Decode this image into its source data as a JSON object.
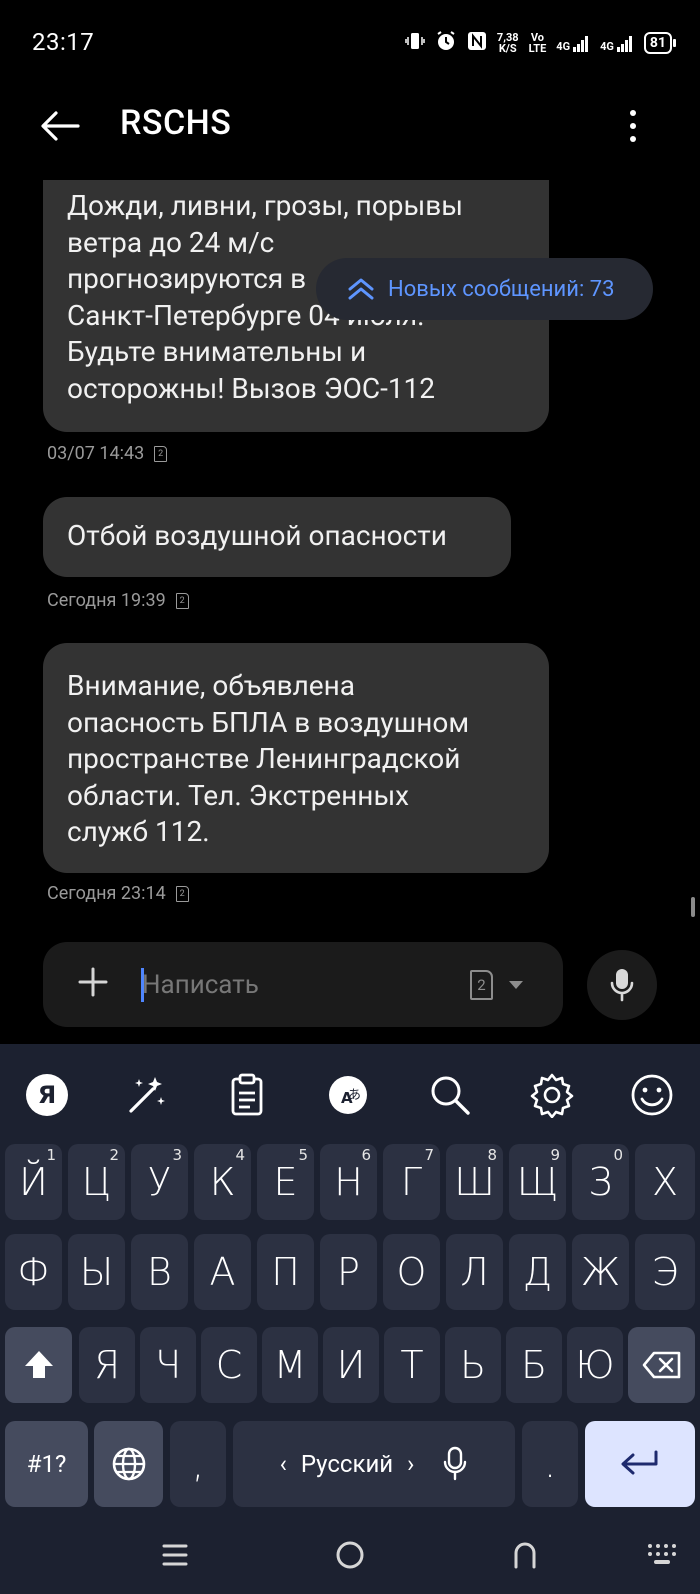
{
  "status_bar": {
    "time": "23:17",
    "net_speed_value": "7,38",
    "net_speed_unit": "K/S",
    "volte_top": "Vo",
    "volte_bottom": "LTE",
    "sig1": "4G",
    "sig2": "4G",
    "battery": "81"
  },
  "app_bar": {
    "title": "RSCHS"
  },
  "new_messages": {
    "label": "Новых сообщений: 73"
  },
  "messages": [
    {
      "lines": [
        "Дожди, ливни, грозы, порывы",
        "ветра до 24 м/с",
        "прогнозируются в",
        "Санкт-Петербурге 04 июля.",
        "Будьте внимательны и",
        "осторожны! Вызов ЭОС-112"
      ],
      "time": "03/07 14:43",
      "sim": "2"
    },
    {
      "lines": [
        "Отбой воздушной опасности"
      ],
      "time": "Сегодня 19:39",
      "sim": "2"
    },
    {
      "lines": [
        "Внимание, объявлена",
        "опасность БПЛА в воздушном",
        "пространстве Ленинградской",
        "области. Тел. Экстренных",
        "служб 112."
      ],
      "time": "Сегодня 23:14",
      "sim": "2"
    }
  ],
  "compose": {
    "placeholder": "Написать",
    "sim": "2"
  },
  "keyboard": {
    "row1": [
      {
        "char": "Й",
        "num": "1"
      },
      {
        "char": "Ц",
        "num": "2"
      },
      {
        "char": "У",
        "num": "3"
      },
      {
        "char": "К",
        "num": "4"
      },
      {
        "char": "Е",
        "num": "5"
      },
      {
        "char": "Н",
        "num": "6"
      },
      {
        "char": "Г",
        "num": "7"
      },
      {
        "char": "Ш",
        "num": "8"
      },
      {
        "char": "Щ",
        "num": "9"
      },
      {
        "char": "З",
        "num": "0"
      },
      {
        "char": "Х",
        "num": ""
      }
    ],
    "row2": [
      "Ф",
      "Ы",
      "В",
      "А",
      "П",
      "Р",
      "О",
      "Л",
      "Д",
      "Ж",
      "Э"
    ],
    "row3": [
      "Я",
      "Ч",
      "С",
      "М",
      "И",
      "Т",
      "Ь",
      "Б",
      "Ю"
    ],
    "symbols_label": "#1?",
    "comma": ",",
    "period": ".",
    "space_label": "Русский",
    "space_left_arrow": "‹",
    "space_right_arrow": "›"
  },
  "colors": {
    "bubble": "#333333",
    "accent": "#5e95ff",
    "keyboard_bg": "#1c2130",
    "key_bg": "#2c3142"
  }
}
